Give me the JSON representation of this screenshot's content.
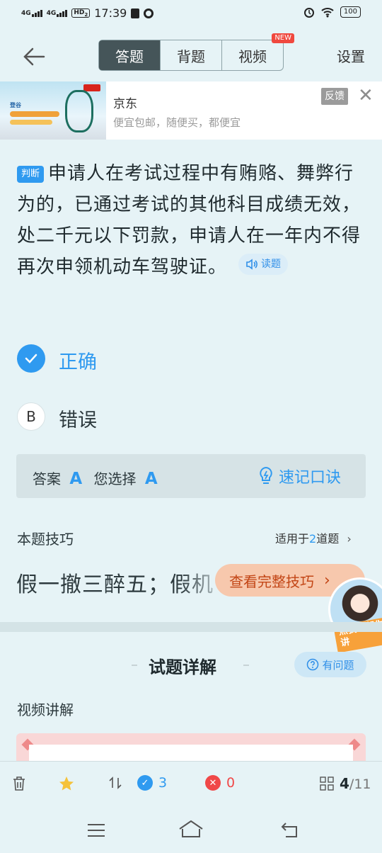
{
  "status_bar": {
    "net1": "4G",
    "net2": "4G",
    "hd": "HD",
    "hd_sub": "2",
    "time": "17:39",
    "battery": "100"
  },
  "nav": {
    "tabs": [
      {
        "label": "答题",
        "active": true
      },
      {
        "label": "背题",
        "active": false
      },
      {
        "label": "视频",
        "active": false
      }
    ],
    "new_badge": "NEW",
    "settings": "设置"
  },
  "ad": {
    "title": "京东",
    "subtitle": "便宜包邮，随便买，都便宜",
    "feedback": "反馈"
  },
  "question": {
    "tag": "判断",
    "text": "申请人在考试过程中有贿赂、舞弊行为的，已通过考试的其他科目成绩无效，处二千元以下罚款，申请人在一年内不得再次申领机动车驾驶证。",
    "read_label": "读题"
  },
  "options": [
    {
      "key": "A",
      "label": "正确",
      "selected": true
    },
    {
      "key": "B",
      "label": "错误",
      "selected": false
    }
  ],
  "answer": {
    "answer_label": "答案",
    "answer_value": "A",
    "chosen_label": "您选择",
    "chosen_value": "A",
    "mnemonic": "速记口诀"
  },
  "tips": {
    "title": "本题技巧",
    "apply_prefix": "适用于",
    "apply_count": "2",
    "apply_suffix": "道题",
    "content": "假一撤三醉五；假机",
    "full_button": "查看完整技巧",
    "assistant_bubble": "点我！帮你讲"
  },
  "explanation": {
    "title": "试题详解",
    "ask_button": "有问题",
    "video_section": "视频讲解"
  },
  "toolbar": {
    "correct_count": "3",
    "wrong_count": "0",
    "current": "4",
    "total": "/11"
  },
  "colors": {
    "accent": "#2f9af0",
    "background": "#e6f3f6",
    "tab_active": "#455559",
    "tip_button": "#f7c8ad",
    "wrong": "#f04848"
  }
}
